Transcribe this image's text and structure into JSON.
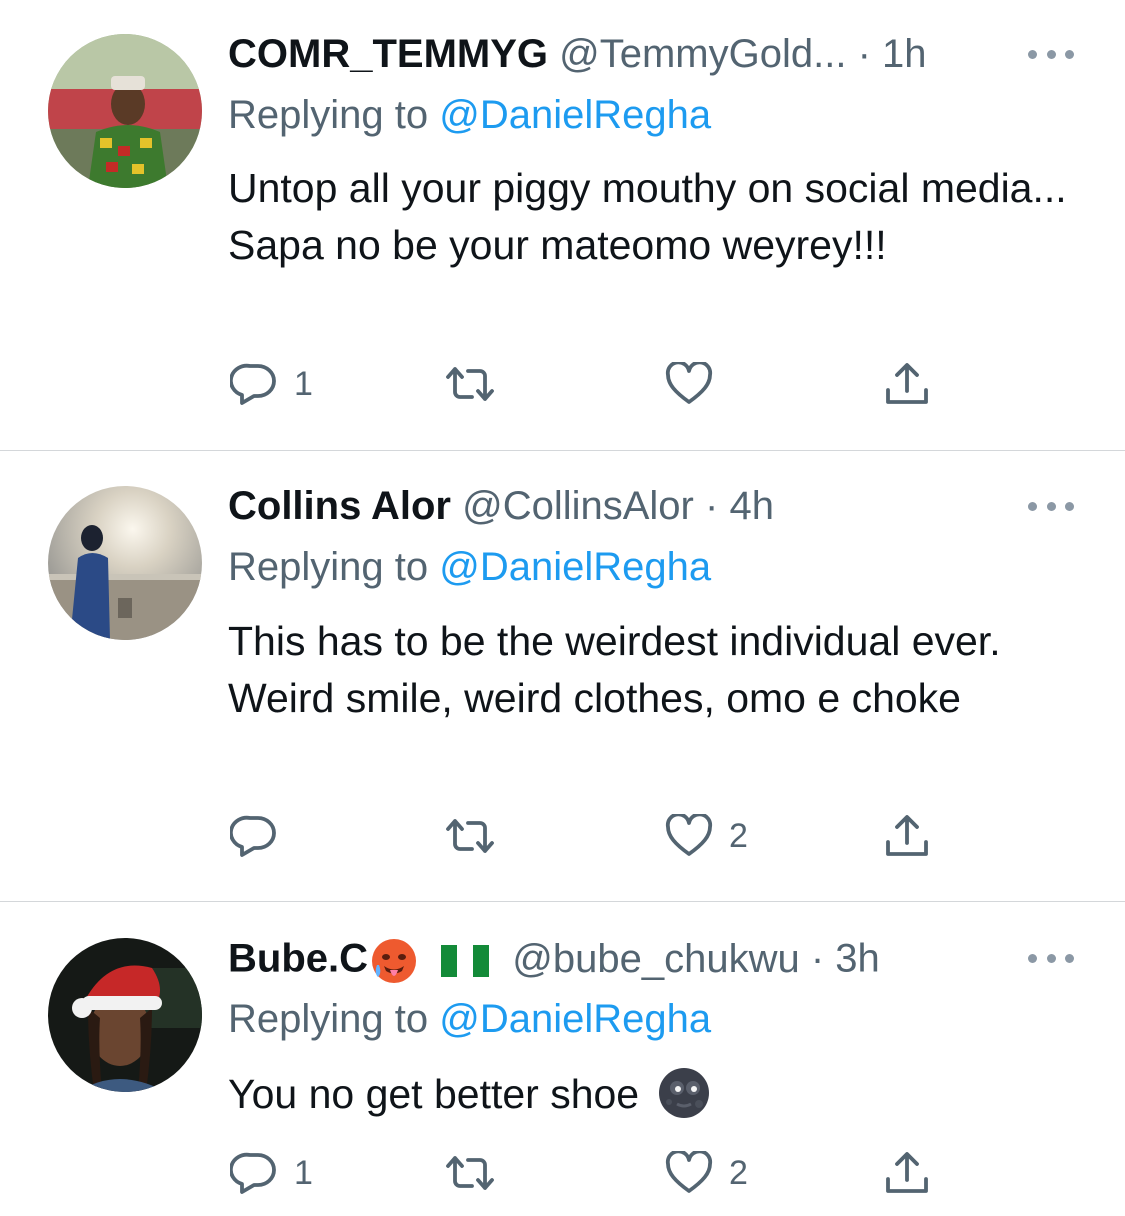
{
  "replies": [
    {
      "name": "COMR_TEMMYG",
      "handle": "@TemmyGold...",
      "time": "1h",
      "replying_prefix": "Replying to",
      "replying_to": "@DanielRegha",
      "text": "Untop all your piggy mouthy on social media... Sapa no be your mateomo weyrey!!!",
      "reply_count": "1",
      "retweet_count": "",
      "like_count": ""
    },
    {
      "name": "Collins Alor",
      "handle": "@CollinsAlor",
      "time": "4h",
      "replying_prefix": "Replying to",
      "replying_to": "@DanielRegha",
      "text": "This has to be the weirdest individual ever. Weird smile, weird clothes, omo e choke",
      "reply_count": "",
      "retweet_count": "",
      "like_count": "2"
    },
    {
      "name": "Bube.C",
      "name_emojis": [
        "hot-face-emoji",
        "nigeria-flag-emoji"
      ],
      "handle": "@bube_chukwu",
      "time": "3h",
      "replying_prefix": "Replying to",
      "replying_to": "@DanielRegha",
      "text": "You no get better shoe",
      "text_emoji": "new-moon-face-emoji",
      "reply_count": "1",
      "retweet_count": "",
      "like_count": "2"
    }
  ],
  "separator": "·",
  "colors": {
    "text": "#0f1419",
    "secondary": "#536471",
    "link": "#1d9bf0",
    "divider": "#d4d7da"
  },
  "icons": [
    "reply-icon",
    "retweet-icon",
    "like-icon",
    "share-icon",
    "more-icon"
  ]
}
